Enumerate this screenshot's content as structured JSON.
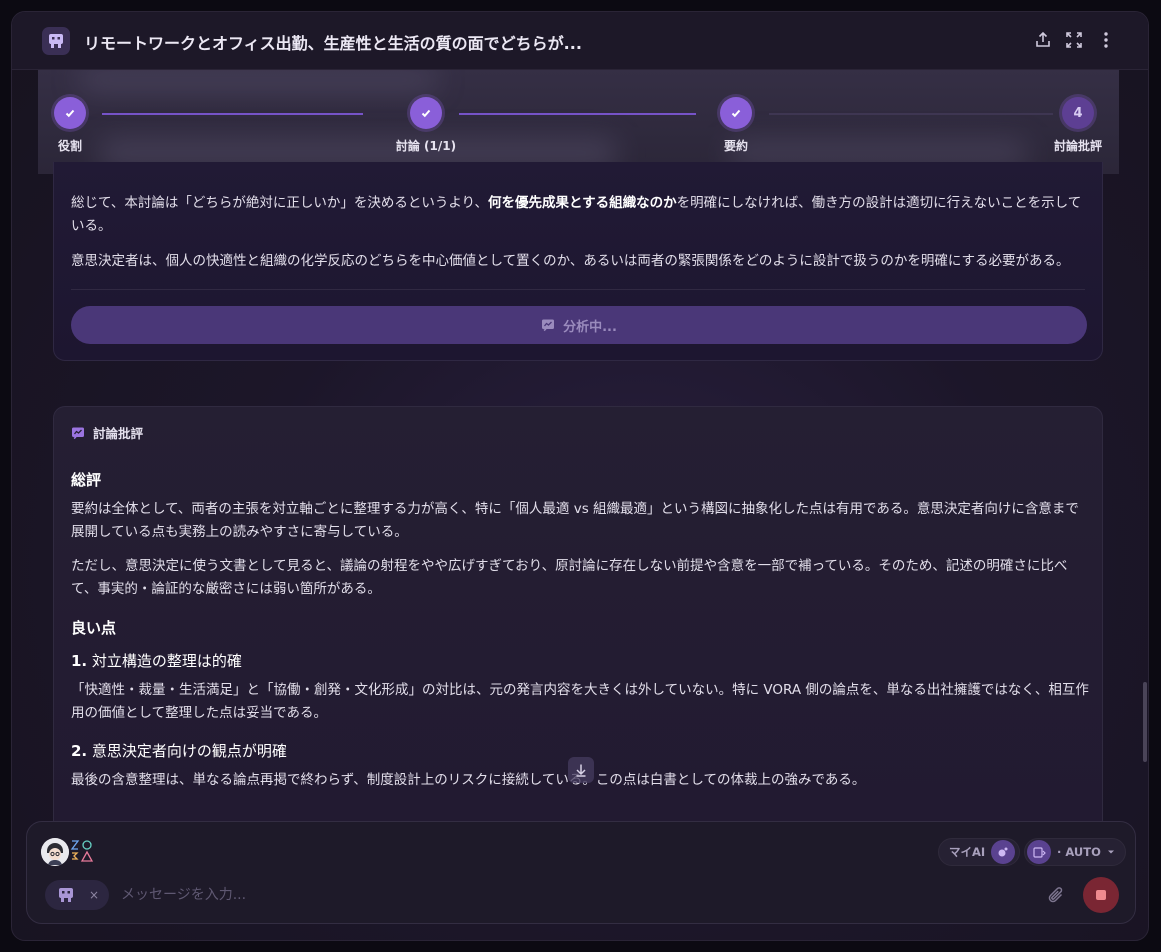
{
  "header": {
    "title": "リモートワークとオフィス出勤、生産性と生活の質の面でどちらが...",
    "icons": [
      "app-robot-icon",
      "share-icon",
      "fullscreen-icon",
      "more-vertical-icon"
    ]
  },
  "stepper": {
    "steps": [
      {
        "label": "役割",
        "state": "done"
      },
      {
        "label": "討論 (1/1)",
        "state": "done"
      },
      {
        "label": "要約",
        "state": "done"
      },
      {
        "label": "討論批評",
        "state": "pending",
        "number": "4"
      }
    ]
  },
  "summary": {
    "p1_pre": "総じて、本討論は「どちらが絶対に正しいか」を決めるというより、",
    "p1_bold": "何を優先成果とする組織なのか",
    "p1_post": "を明確にしなければ、働き方の設計は適切に行えないことを示している。",
    "p2": "意思決定者は、個人の快適性と組織の化学反応のどちらを中心価値として置くのか、あるいは両者の緊張関係をどのように設計で扱うのかを明確にする必要がある。",
    "analyze_label": "分析中..."
  },
  "critique": {
    "heading": "討論批評",
    "overall_title": "総評",
    "overall_p1": "要約は全体として、両者の主張を対立軸ごとに整理する力が高く、特に「個人最適 vs 組織最適」という構図に抽象化した点は有用である。意思決定者向けに含意まで展開している点も実務上の読みやすさに寄与している。",
    "overall_p2": "ただし、意思決定に使う文書として見ると、議論の射程をやや広げすぎており、原討論に存在しない前提や含意を一部で補っている。そのため、記述の明確さに比べて、事実的・論証的な厳密さには弱い箇所がある。",
    "good_title": "良い点",
    "point1_num": "1.",
    "point1_title": "対立構造の整理は的確",
    "point1_text": "「快適性・裁量・生活満足」と「協働・創発・文化形成」の対比は、元の発言内容を大きくは外していない。特に VORA 側の論点を、単なる出社擁護ではなく、相互作用の価値として整理した点は妥当である。",
    "point2_num": "2.",
    "point2_title": "意思決定者向けの観点が明確",
    "point2_text": "最後の含意整理は、単なる論点再掲で終わらず、制度設計上のリスクに接続している。この点は白書としての体裁上の強みである。"
  },
  "composer": {
    "my_ai_label": "マイAI",
    "mode_label": "· AUTO",
    "placeholder": "メッセージを入力...",
    "chip_close": "×"
  },
  "colors": {
    "accent": "#8a5fd9",
    "stop": "#7a2633"
  }
}
